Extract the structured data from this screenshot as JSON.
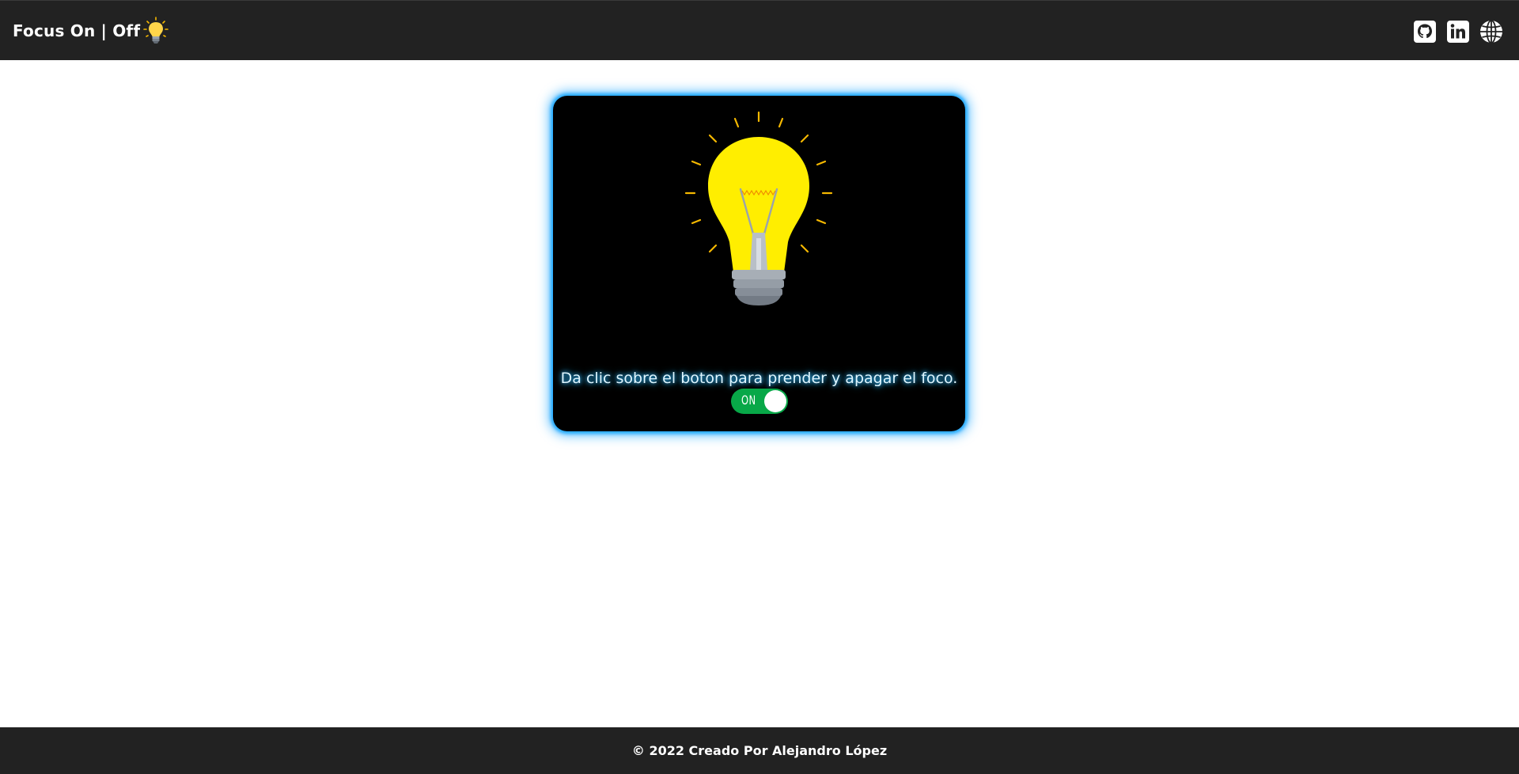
{
  "navbar": {
    "brand": "Focus On | Off",
    "brand_icon": "lightbulb-icon",
    "links": [
      {
        "name": "github-icon"
      },
      {
        "name": "linkedin-icon"
      },
      {
        "name": "globe-icon"
      }
    ]
  },
  "card": {
    "instruction": "Da clic sobre el boton para prender y apagar el foco.",
    "toggle": {
      "label": "ON",
      "state": "on"
    }
  },
  "footer": {
    "text": "© 2022 Creado Por Alejandro López"
  },
  "colors": {
    "navbar_bg": "#222222",
    "card_bg": "#000000",
    "card_glow": "#22aaff",
    "bulb_yellow": "#ffee00",
    "ray_color": "#f5b800",
    "toggle_on": "#08a848"
  }
}
